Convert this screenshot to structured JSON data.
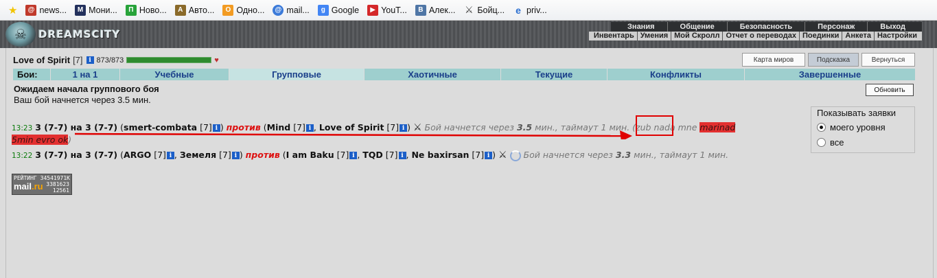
{
  "bookmarks": [
    {
      "label": "news...",
      "icon": "mailru-news-icon",
      "color": "#c0392b"
    },
    {
      "label": "Мони...",
      "icon": "monitor-icon",
      "color": "#22305c"
    },
    {
      "label": "Ново...",
      "icon": "green-p-icon",
      "color": "#27a33a"
    },
    {
      "label": "Авто...",
      "icon": "car-icon",
      "color": "#8a6a2a"
    },
    {
      "label": "Одно...",
      "icon": "odnoklassniki-icon",
      "color": "#f29b23"
    },
    {
      "label": "mail...",
      "icon": "mail-at-icon",
      "color": "#3b7ad9"
    },
    {
      "label": "Google",
      "icon": "google-icon",
      "color": "#4285f4"
    },
    {
      "label": "YouT...",
      "icon": "youtube-icon",
      "color": "#d4282a"
    },
    {
      "label": "Алек...",
      "icon": "vk-icon",
      "color": "#4f76a6"
    },
    {
      "label": "Бойц...",
      "icon": "crossed-swords-icon",
      "color": "#555555"
    },
    {
      "label": "priv...",
      "icon": "ie-icon",
      "color": "#2a6fd1"
    }
  ],
  "header": {
    "logo_text": "DREAMSCITY",
    "top_menu": [
      "Знания",
      "Общение",
      "Безопасность",
      "Персонаж",
      "Выход"
    ],
    "sub_menu": [
      "Инвентарь",
      "Умения",
      "Мой Скролл",
      "Отчет о переводах",
      "Поединки",
      "Анкета",
      "Настройки"
    ]
  },
  "character": {
    "name": "Love of Spirit",
    "level": "[7]",
    "hp": "873/873",
    "hp_fraction": 1.0
  },
  "buttons": {
    "map": "Карта миров",
    "hint": "Подсказка",
    "back": "Вернуться",
    "refresh": "Обновить"
  },
  "tabs": {
    "label": "Бои:",
    "items": [
      "1 на 1",
      "Учебные",
      "Групповые",
      "Хаотичные",
      "Текущие",
      "Конфликты",
      "Завершенные"
    ],
    "active": "Групповые"
  },
  "status": {
    "title": "Ожидаем начала группового боя",
    "text": "Ваш бой начнется через 3.5 мин."
  },
  "filter": {
    "title": "Показывать заявки",
    "options": [
      "моего уровня",
      "все"
    ],
    "selected": "моего уровня"
  },
  "battles": [
    {
      "time": "13:23",
      "teams_a": "3 (7-7) на 3 (7-7)",
      "side_a": [
        "smert-combata"
      ],
      "vs": "против",
      "side_b": [
        "Mind",
        "Love of Spirit"
      ],
      "level": "[7]",
      "note_prefix": "Бой начнется через",
      "minutes": "3.5",
      "note_mid": "мин., таймаут",
      "timeout": "1 мин.",
      "comment_a": "(zub nada mne",
      "comment_hl1": "marinad",
      "comment_hl2": "5min evro ok",
      "comment_end": ")"
    },
    {
      "time": "13:22",
      "teams_a": "3 (7-7) на 3 (7-7)",
      "side_a": [
        "ARGO",
        "Земеля"
      ],
      "vs": "против",
      "side_b": [
        "I am Baku",
        "TQD",
        "Ne baxirsan"
      ],
      "level": "[7]",
      "note_prefix": "Бой начнется через",
      "minutes": "3.3",
      "note_mid": "мин., таймаут 1 мин."
    }
  ],
  "counter": {
    "label": "РЕЙТИНГ",
    "code": "34541971K",
    "logo_a": "mail",
    "logo_b": ".ru",
    "num1": "3381623",
    "num2": "12561"
  },
  "annotation_color": "#e00000"
}
